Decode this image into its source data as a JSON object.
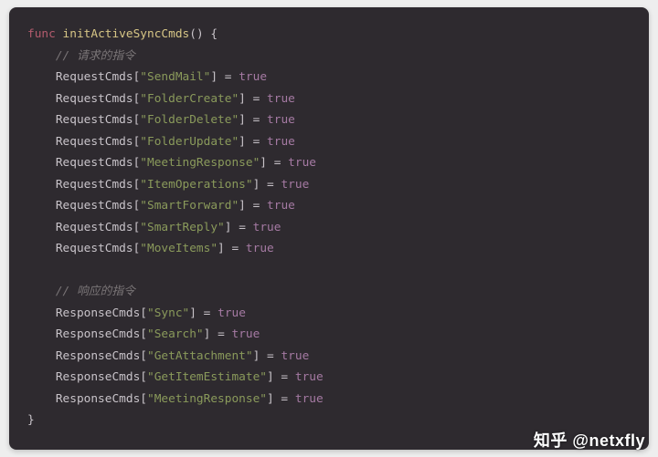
{
  "code": {
    "keyword_func": "func",
    "func_name": "initActiveSyncCmds",
    "parens": "()",
    "brace_open": "{",
    "brace_close": "}",
    "comment_request": "// 请求的指令",
    "comment_response": "// 响应的指令",
    "ident_request": "RequestCmds",
    "ident_response": "ResponseCmds",
    "op_assign": "=",
    "bool_true": "true",
    "request_keys": [
      "\"SendMail\"",
      "\"FolderCreate\"",
      "\"FolderDelete\"",
      "\"FolderUpdate\"",
      "\"MeetingResponse\"",
      "\"ItemOperations\"",
      "\"SmartForward\"",
      "\"SmartReply\"",
      "\"MoveItems\""
    ],
    "response_keys": [
      "\"Sync\"",
      "\"Search\"",
      "\"GetAttachment\"",
      "\"GetItemEstimate\"",
      "\"MeetingResponse\""
    ]
  },
  "watermark": "知乎 @netxfly"
}
